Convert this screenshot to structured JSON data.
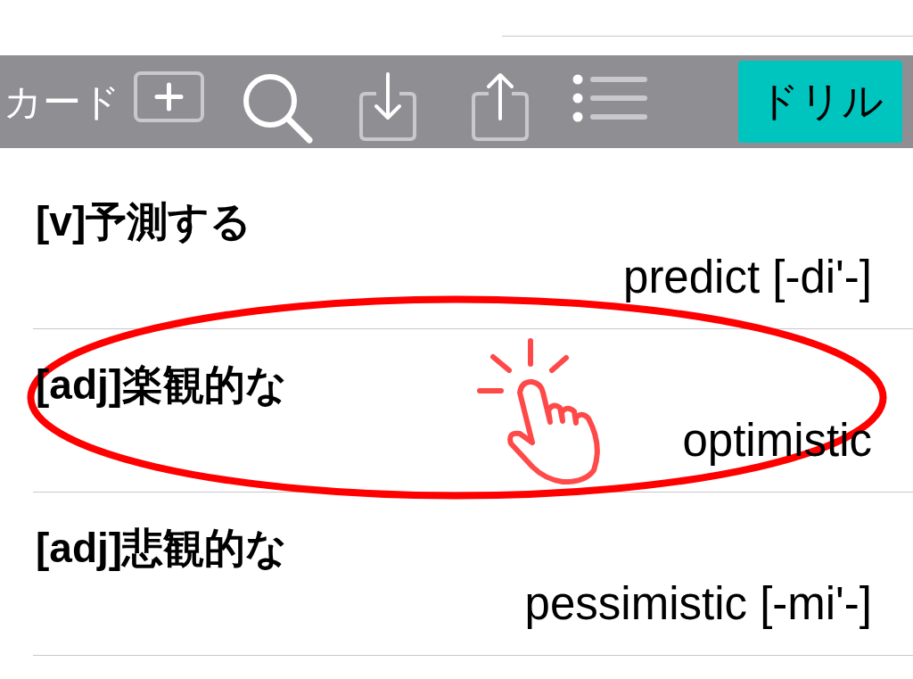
{
  "toolbar": {
    "label": "カード",
    "icons": [
      {
        "kind": "add"
      },
      {
        "kind": "search"
      },
      {
        "kind": "import"
      },
      {
        "kind": "export"
      },
      {
        "kind": "list"
      }
    ],
    "button": "ドリル"
  },
  "cards": [
    {
      "term": "[v]予測する",
      "answer": "predict [-di'-]",
      "highlighted": false
    },
    {
      "term": "[adj]楽観的な",
      "answer": "optimistic",
      "highlighted": true
    },
    {
      "term": "[adj]悲観的な",
      "answer": "pessimistic [-mi'-]",
      "highlighted": false
    }
  ]
}
